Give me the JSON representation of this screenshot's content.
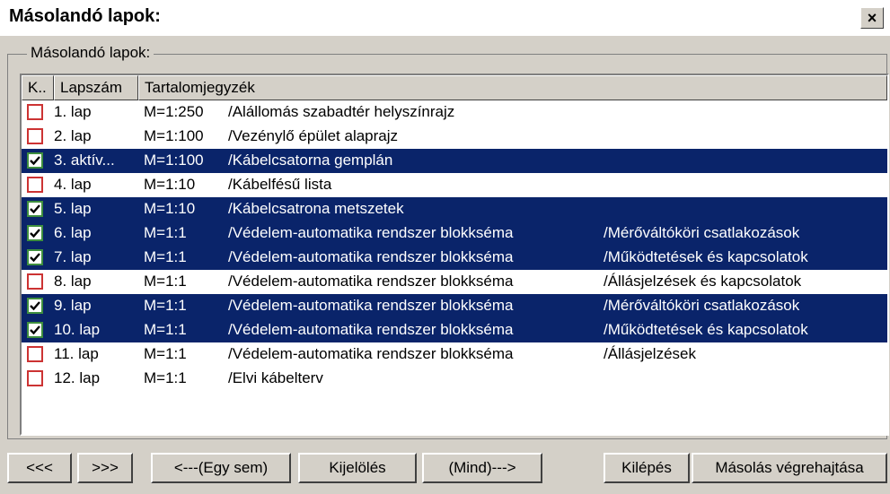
{
  "window": {
    "title": "Másolandó lapok:",
    "close_label": "×"
  },
  "group": {
    "label": "Másolandó lapok:"
  },
  "columns": [
    "K..",
    "Lapszám",
    "Tartalomjegyzék"
  ],
  "rows": [
    {
      "checked": false,
      "num": "1. lap",
      "scale": "M=1:250",
      "desc": "/Alállomás szabadtér helyszínrajz",
      "desc2": ""
    },
    {
      "checked": false,
      "num": "2. lap",
      "scale": "M=1:100",
      "desc": "/Vezénylő épület alaprajz",
      "desc2": ""
    },
    {
      "checked": true,
      "num": "3. aktív...",
      "scale": "M=1:100",
      "desc": "/Kábelcsatorna gemplán",
      "desc2": ""
    },
    {
      "checked": false,
      "num": "4. lap",
      "scale": "M=1:10",
      "desc": "/Kábelfésű lista",
      "desc2": ""
    },
    {
      "checked": true,
      "num": "5. lap",
      "scale": "M=1:10",
      "desc": "/Kábelcsatrona metszetek",
      "desc2": ""
    },
    {
      "checked": true,
      "num": "6. lap",
      "scale": "M=1:1",
      "desc": "/Védelem-automatika rendszer blokkséma",
      "desc2": "/Mérőváltóköri csatlakozások"
    },
    {
      "checked": true,
      "num": "7. lap",
      "scale": "M=1:1",
      "desc": "/Védelem-automatika rendszer blokkséma",
      "desc2": "/Működtetések és kapcsolatok"
    },
    {
      "checked": false,
      "num": "8. lap",
      "scale": "M=1:1",
      "desc": "/Védelem-automatika rendszer blokkséma",
      "desc2": "/Állásjelzések és kapcsolatok"
    },
    {
      "checked": true,
      "num": "9. lap",
      "scale": "M=1:1",
      "desc": "/Védelem-automatika rendszer blokkséma",
      "desc2": "/Mérőváltóköri csatlakozások"
    },
    {
      "checked": true,
      "num": "10. lap",
      "scale": "M=1:1",
      "desc": "/Védelem-automatika rendszer blokkséma",
      "desc2": "/Működtetések és kapcsolatok"
    },
    {
      "checked": false,
      "num": "11. lap",
      "scale": "M=1:1",
      "desc": "/Védelem-automatika rendszer blokkséma",
      "desc2": "/Állásjelzések"
    },
    {
      "checked": false,
      "num": "12. lap",
      "scale": "M=1:1",
      "desc": "/Elvi kábelterv",
      "desc2": ""
    }
  ],
  "buttons": {
    "prev": "<<<",
    "next": ">>>",
    "select_none": "<---(Egy sem)",
    "select": "Kijelölés",
    "select_all": "(Mind)--->",
    "exit": "Kilépés",
    "execute": "Másolás végrehajtása"
  }
}
